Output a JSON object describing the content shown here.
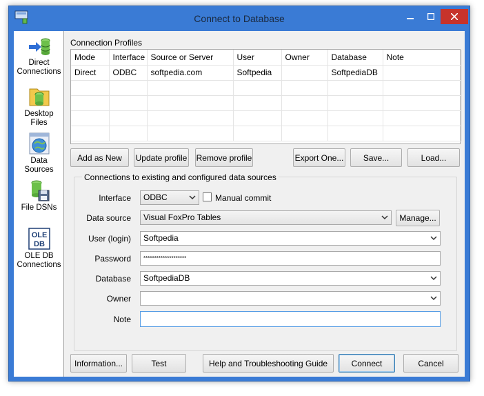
{
  "window": {
    "title": "Connect to Database",
    "accent": "#3a7bd5"
  },
  "sidebar": {
    "items": [
      {
        "label1": "Direct",
        "label2": "Connections",
        "icon": "direct-connections-icon"
      },
      {
        "label1": "Desktop",
        "label2": "Files",
        "icon": "desktop-files-icon"
      },
      {
        "label1": "Data",
        "label2": "Sources",
        "icon": "data-sources-icon"
      },
      {
        "label1": "File DSNs",
        "label2": "",
        "icon": "file-dsns-icon"
      },
      {
        "label1": "OLE DB",
        "label2": "Connections",
        "icon": "ole-db-icon",
        "icon_text1": "OLE",
        "icon_text2": "DB"
      }
    ]
  },
  "profiles": {
    "title": "Connection Profiles",
    "columns": [
      "Mode",
      "Interface",
      "Source or Server",
      "User",
      "Owner",
      "Database",
      "Note"
    ],
    "rows": [
      [
        "Direct",
        "ODBC",
        "softpedia.com",
        "Softpedia",
        "",
        "SoftpediaDB",
        ""
      ]
    ],
    "buttons": {
      "add": "Add as New",
      "update": "Update profile",
      "remove": "Remove profile",
      "export": "Export One...",
      "save": "Save...",
      "load": "Load..."
    }
  },
  "connection": {
    "group_title": "Connections to existing and configured data sources",
    "interface_label": "Interface",
    "interface_value": "ODBC",
    "manual_commit_label": "Manual commit",
    "manual_commit_checked": false,
    "datasource_label": "Data source",
    "datasource_value": "Visual FoxPro Tables",
    "manage_label": "Manage...",
    "user_label": "User (login)",
    "user_value": "Softpedia",
    "password_label": "Password",
    "password_value": "********************",
    "database_label": "Database",
    "database_value": "SoftpediaDB",
    "owner_label": "Owner",
    "owner_value": "",
    "note_label": "Note",
    "note_value": ""
  },
  "footer": {
    "information": "Information...",
    "test": "Test",
    "help": "Help and Troubleshooting Guide",
    "connect": "Connect",
    "cancel": "Cancel"
  }
}
